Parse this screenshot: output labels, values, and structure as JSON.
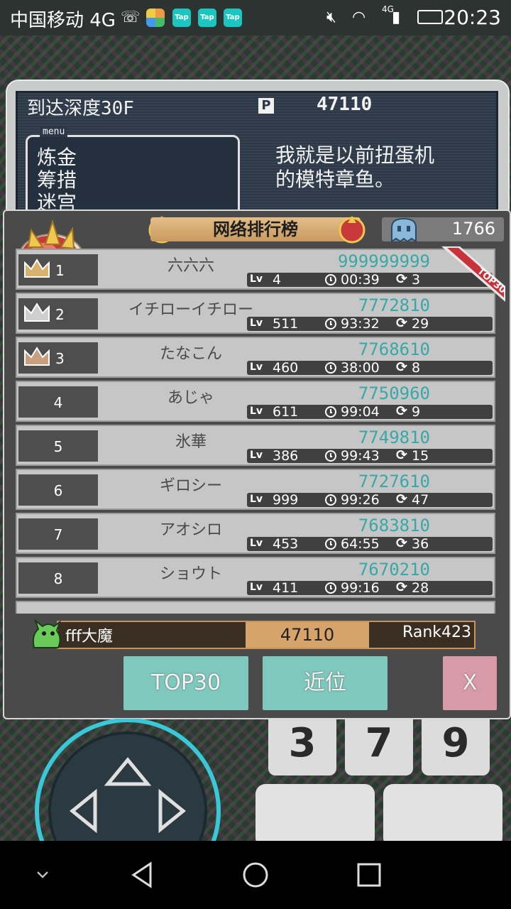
{
  "status_bar": {
    "carrier": "中国移动 4G",
    "apps": [
      "Tap",
      "Tap",
      "Tap"
    ],
    "network": "4G",
    "time": "20:23"
  },
  "game": {
    "depth_label": "到达深度30F",
    "currency_icon": "P",
    "gold": "47110",
    "menu_tag": "menu",
    "menu_items": [
      "炼金",
      "筹措",
      "迷宫"
    ],
    "dialog": [
      "我就是以前扭蛋机",
      "的模特章鱼。"
    ]
  },
  "ranking": {
    "title": "网络排行榜",
    "top_score": "1766",
    "ribbon": "TOP30",
    "rows": [
      {
        "rank": "1",
        "crown": "gold",
        "name": "六六六",
        "score": "999999999",
        "lv": "4",
        "time": "00:39",
        "loops": "3"
      },
      {
        "rank": "2",
        "crown": "silver",
        "name": "イチローイチロー",
        "score": "7772810",
        "lv": "511",
        "time": "93:32",
        "loops": "29"
      },
      {
        "rank": "3",
        "crown": "bronze",
        "name": "たなこん",
        "score": "7768610",
        "lv": "460",
        "time": "38:00",
        "loops": "8"
      },
      {
        "rank": "4",
        "crown": "",
        "name": "あじゃ",
        "score": "7750960",
        "lv": "611",
        "time": "99:04",
        "loops": "9"
      },
      {
        "rank": "5",
        "crown": "",
        "name": "氷華",
        "score": "7749810",
        "lv": "386",
        "time": "99:43",
        "loops": "15"
      },
      {
        "rank": "6",
        "crown": "",
        "name": "ギロシー",
        "score": "7727610",
        "lv": "999",
        "time": "99:26",
        "loops": "47"
      },
      {
        "rank": "7",
        "crown": "",
        "name": "アオシロ",
        "score": "7683810",
        "lv": "453",
        "time": "64:55",
        "loops": "36"
      },
      {
        "rank": "8",
        "crown": "",
        "name": "ショウト",
        "score": "7670210",
        "lv": "411",
        "time": "99:16",
        "loops": "28"
      }
    ],
    "lv_tag": "Lv",
    "player": {
      "name": "fff大魔",
      "score": "47110",
      "rank": "Rank423"
    },
    "buttons": {
      "top30": "TOP30",
      "nearby": "近位",
      "close": "X"
    }
  },
  "controls": {
    "keys": [
      "3",
      "7",
      "9"
    ]
  },
  "colors": {
    "panel": "#4a4a4a",
    "row": "#c6c6c6",
    "score": "#3aa7a7",
    "button_teal": "#7fc8bd",
    "button_pink": "#d79aa6"
  }
}
